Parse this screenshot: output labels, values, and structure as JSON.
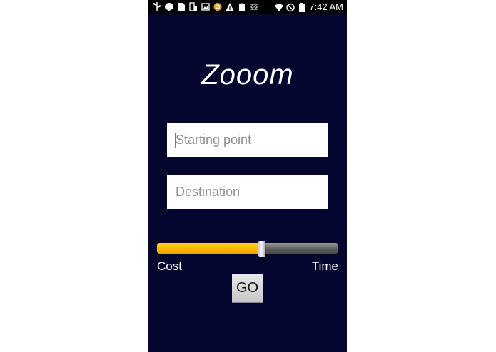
{
  "status_bar": {
    "time": "7:42 AM",
    "left_icons": [
      "usb-icon",
      "messenger-icon",
      "sim-icon",
      "phone-tablet-icon",
      "image-icon",
      "app-o-icon",
      "warning-icon",
      "clipboard-icon",
      "voicemail-icon"
    ],
    "right_icons": [
      "wifi-icon",
      "no-signal-icon",
      "battery-icon"
    ]
  },
  "app": {
    "title": "Zooom",
    "background_color": "#04062e"
  },
  "form": {
    "starting_point": {
      "placeholder": "Starting point",
      "value": ""
    },
    "destination": {
      "placeholder": "Destination",
      "value": ""
    },
    "preference_slider": {
      "min_label": "Cost",
      "max_label": "Time",
      "value_fraction": 0.58,
      "fill_color": "#f5b800"
    },
    "go_label": "GO"
  }
}
